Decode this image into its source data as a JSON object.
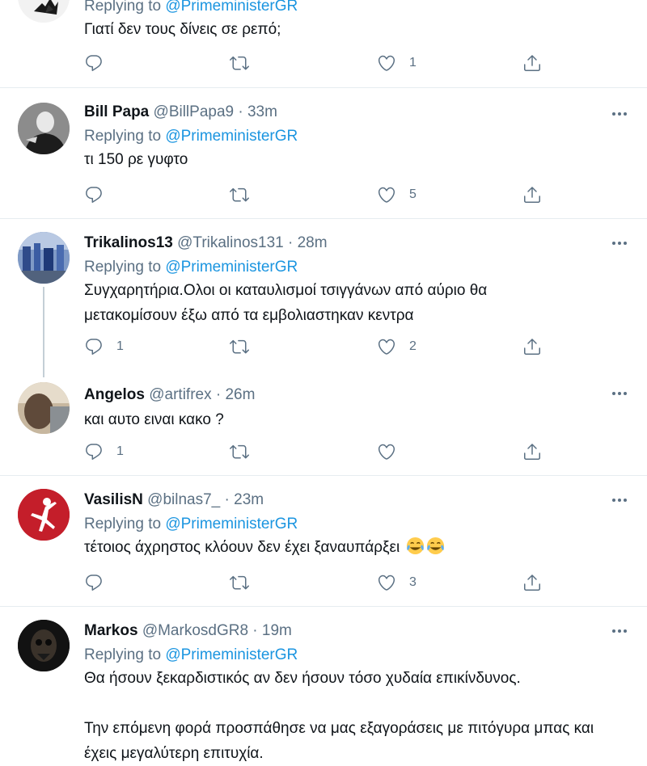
{
  "reply_prefix": "Replying to",
  "tweets": [
    {
      "display_name": "",
      "handle": "",
      "time": "",
      "replying_to": "@PrimeministerGR",
      "lines": [
        "Γιατί δεν τους δίνεις σε ρεπό;"
      ],
      "replies": "",
      "retweets": "",
      "likes": "1"
    },
    {
      "display_name": "Bill Papa",
      "handle": "@BillPapa9 · 33m",
      "replying_to": "@PrimeministerGR",
      "lines": [
        "τι 150 ρε γυφτο"
      ],
      "replies": "",
      "retweets": "",
      "likes": "5"
    },
    {
      "display_name": "Trikalinos13",
      "handle": "@Trikalinos131 · 28m",
      "replying_to": "@PrimeministerGR",
      "lines": [
        "Συγχαρητήρια.Ολοι οι καταυλισμοί τσιγγάνων από αύριο θα",
        "μετακομίσουν έξω από τα εμβολιαστηκαν κεντρα"
      ],
      "replies": "1",
      "retweets": "",
      "likes": "2"
    },
    {
      "display_name": "Angelos",
      "handle": "@artifrex · 26m",
      "lines": [
        "και αυτο ειναι κακο ?"
      ],
      "replies": "1",
      "retweets": "",
      "likes": ""
    },
    {
      "display_name": "VasilisN",
      "handle": "@bilnas7_ · 23m",
      "replying_to": "@PrimeministerGR",
      "lines": [
        "τέτοιος άχρηστος κλόουν δεν έχει ξαναυπάρξει"
      ],
      "emoji": "face-with-tears-of-joy",
      "replies": "",
      "retweets": "",
      "likes": "3"
    },
    {
      "display_name": "Markos",
      "handle": "@MarkosdGR8 · 19m",
      "replying_to": "@PrimeministerGR",
      "lines": [
        "Θα ήσουν ξεκαρδιστικός αν δεν ήσουν τόσο χυδαία επικίνδυνος.",
        "",
        "Την επόμενη φορά προσπάθησε να μας εξαγοράσεις με πιτόγυρα μπας και",
        "έχεις μεγαλύτερη επιτυχία."
      ]
    }
  ],
  "icons": {
    "reply": "speech-bubble-icon",
    "retweet": "retweet-arrows-icon",
    "like": "heart-outline-icon",
    "share": "share-upload-icon",
    "more": "three-dots-icon"
  },
  "colors": {
    "secondary_text": "#5b7083",
    "mention": "#1b95e0",
    "divider": "#e6ecf0",
    "thread_line": "#c4cfd6"
  }
}
